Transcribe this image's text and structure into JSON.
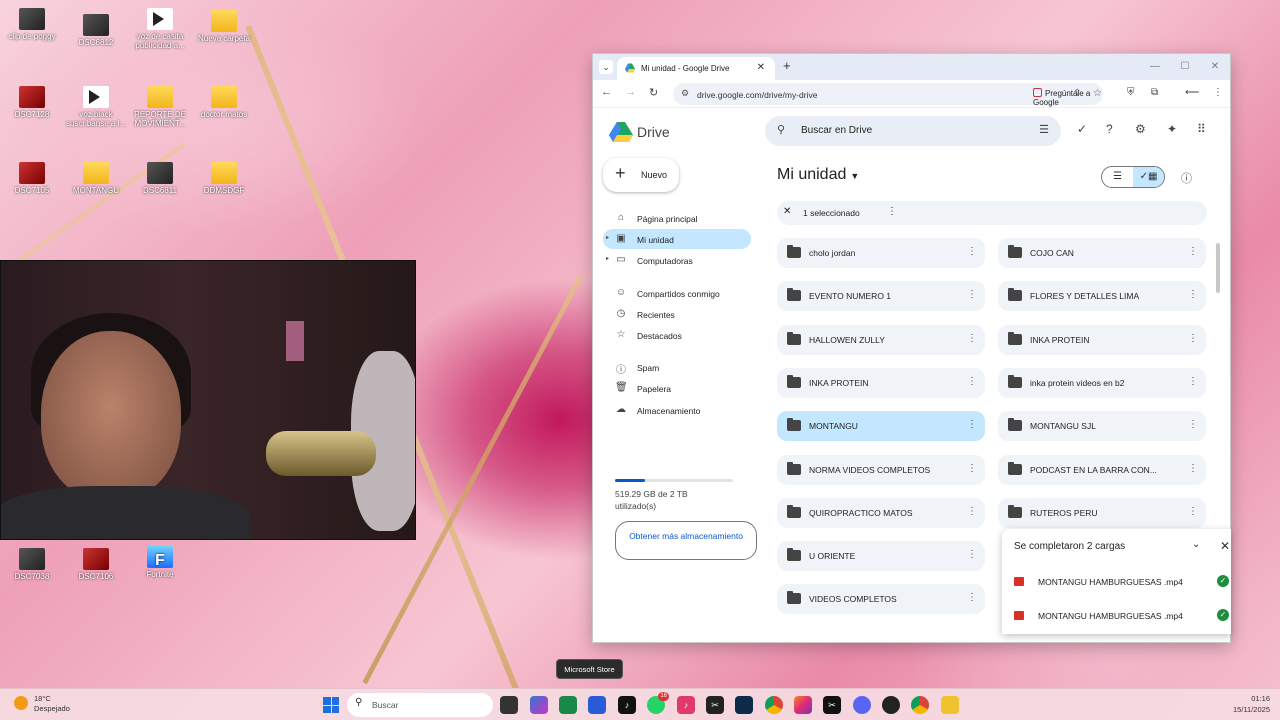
{
  "desktop": {
    "icons": [
      {
        "label": "clip de poggy",
        "kind": "img"
      },
      {
        "label": "DSC6812",
        "kind": "img"
      },
      {
        "label": "voz de casita publicidad a...",
        "kind": "play"
      },
      {
        "label": "Nueva carpeta",
        "kind": "folder"
      },
      {
        "label": "DSC7128",
        "kind": "red"
      },
      {
        "label": "voz black suscribanse a l...",
        "kind": "play"
      },
      {
        "label": "REPORTE DE MOVIMIENT...",
        "kind": "folder"
      },
      {
        "label": "doctor matos",
        "kind": "folder"
      },
      {
        "label": "DSC7105",
        "kind": "red"
      },
      {
        "label": "MONTANGU",
        "kind": "folder"
      },
      {
        "label": "DSC6811",
        "kind": "img"
      },
      {
        "label": "DDMSDGF",
        "kind": "folder"
      },
      {
        "label": "DSC7038",
        "kind": "img"
      },
      {
        "label": "DSC7106",
        "kind": "red"
      },
      {
        "label": "Fortnite",
        "kind": "fort"
      }
    ],
    "fortnite_glyph": "F"
  },
  "browser": {
    "tab_title": "Mi unidad - Google Drive",
    "tab_close": "✕",
    "new_tab": "+",
    "url": "drive.google.com/drive/my-drive",
    "ask_google": "Pregúntale a Google",
    "win_controls": [
      "—",
      "☐",
      "✕"
    ]
  },
  "drive": {
    "logo": "Drive",
    "new_button": "Nuevo",
    "nav": [
      {
        "label": "Página principal",
        "icon": "home-icon",
        "glyph": "⌂"
      },
      {
        "label": "Mi unidad",
        "icon": "drive-icon",
        "glyph": "▣"
      },
      {
        "label": "Computadoras",
        "icon": "computer-icon",
        "glyph": "▭"
      },
      {
        "label": "Compartidos conmigo",
        "icon": "people-icon",
        "glyph": "☺"
      },
      {
        "label": "Recientes",
        "icon": "clock-icon",
        "glyph": "◷"
      },
      {
        "label": "Destacados",
        "icon": "star-icon",
        "glyph": "☆"
      },
      {
        "label": "Spam",
        "icon": "spam-icon",
        "glyph": "ⓘ"
      },
      {
        "label": "Papelera",
        "icon": "trash-icon",
        "glyph": "🗑"
      },
      {
        "label": "Almacenamiento",
        "icon": "cloud-icon",
        "glyph": "☁"
      }
    ],
    "storage_used_fraction": 0.25,
    "storage_text": "519.29 GB de 2 TB utilizado(s)",
    "more_storage": "Obtener más almacenamiento",
    "search_placeholder": "Buscar en Drive",
    "heading": "Mi unidad",
    "selection_text": "1 seleccionado",
    "folders_left": [
      "cholo jordan",
      "EVENTO NUMERO 1",
      "HALLOWEN ZULLY",
      "INKA PROTEIN",
      "MONTANGU",
      "NORMA VIDEOS COMPLETOS",
      "QUIROPRACTICO MATOS",
      "U ORIENTE",
      "VIDEOS COMPLETOS"
    ],
    "folders_right": [
      "COJO CAN",
      "FLORES Y DETALLES LIMA",
      "INKA PROTEIN",
      "inka protein videos en b2",
      "MONTANGU SJL",
      "PODCAST EN LA BARRA CON...",
      "RUTEROS PERU"
    ],
    "selected_folder": "MONTANGU"
  },
  "uploads": {
    "title": "Se completaron 2 cargas",
    "items": [
      "MONTANGU HAMBURGUESAS .mp4",
      "MONTANGU HAMBURGUESAS .mp4"
    ]
  },
  "tooltip": "Microsoft Store",
  "taskbar": {
    "weather_temp": "18°C",
    "weather_desc": "Despejado",
    "search": "Buscar",
    "time": "01:16",
    "date": "15/11/2025",
    "badge_whatsapp": "16"
  }
}
